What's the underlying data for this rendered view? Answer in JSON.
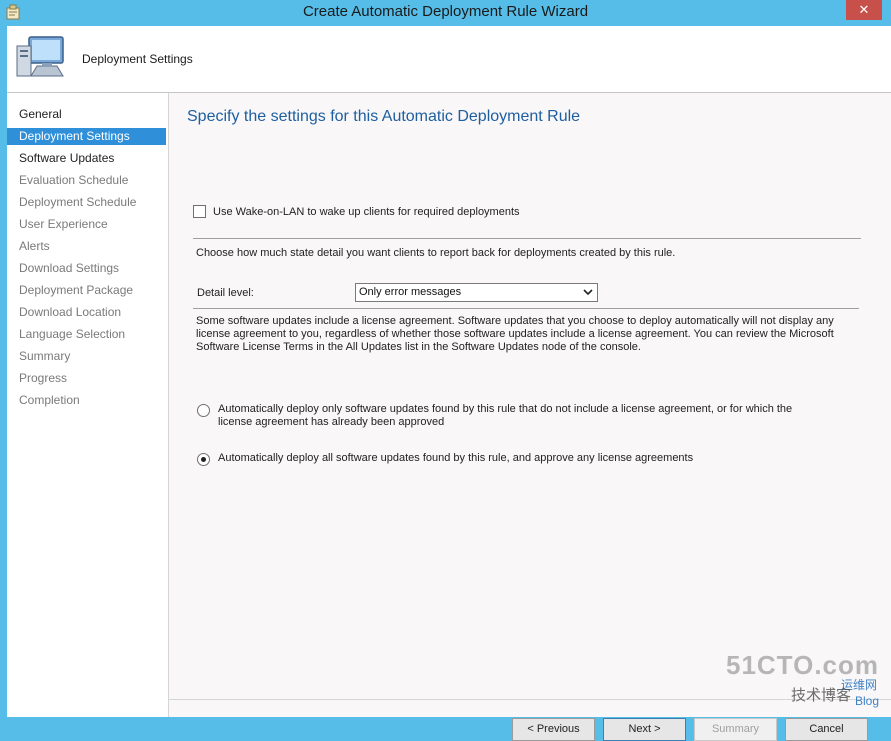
{
  "window": {
    "title": "Create Automatic Deployment Rule Wizard",
    "close_label": "✕"
  },
  "header": {
    "title": "Deployment Settings"
  },
  "nav": {
    "items": [
      {
        "label": "General",
        "state": "done"
      },
      {
        "label": "Deployment Settings",
        "state": "active"
      },
      {
        "label": "Software Updates",
        "state": "done"
      },
      {
        "label": "Evaluation Schedule",
        "state": "pending"
      },
      {
        "label": "Deployment Schedule",
        "state": "pending"
      },
      {
        "label": "User Experience",
        "state": "pending"
      },
      {
        "label": "Alerts",
        "state": "pending"
      },
      {
        "label": "Download Settings",
        "state": "pending"
      },
      {
        "label": "Deployment Package",
        "state": "pending"
      },
      {
        "label": "Download Location",
        "state": "pending"
      },
      {
        "label": "Language Selection",
        "state": "pending"
      },
      {
        "label": "Summary",
        "state": "pending"
      },
      {
        "label": "Progress",
        "state": "pending"
      },
      {
        "label": "Completion",
        "state": "pending"
      }
    ]
  },
  "main": {
    "heading": "Specify the settings for this Automatic Deployment Rule",
    "wake_on_lan": {
      "label": "Use Wake-on-LAN to wake up clients for required deployments",
      "checked": false
    },
    "state_detail_text": "Choose how much state detail you want clients to report back for deployments created by this rule.",
    "detail_level": {
      "label": "Detail level:",
      "value": "Only error messages"
    },
    "license_text": "Some software updates include a license agreement. Software updates that you choose to deploy automatically will not display any license agreement to you, regardless of whether those software updates include a license agreement. You can review the Microsoft Software License Terms in the All Updates list in the Software Updates node of the console.",
    "radio_options": [
      {
        "label": "Automatically deploy only software updates found by this rule that do not include a license agreement, or for which the license agreement has already been approved",
        "checked": false
      },
      {
        "label": "Automatically deploy all software updates found by this rule, and approve any license agreements",
        "checked": true
      }
    ]
  },
  "footer": {
    "previous_label": "< Previous",
    "next_label": "Next >",
    "summary_label": "Summary",
    "cancel_label": "Cancel"
  },
  "watermark": {
    "line1": "51CTO.com",
    "line2": "技术博客",
    "line3": "运维网",
    "line4": "Blog"
  }
}
